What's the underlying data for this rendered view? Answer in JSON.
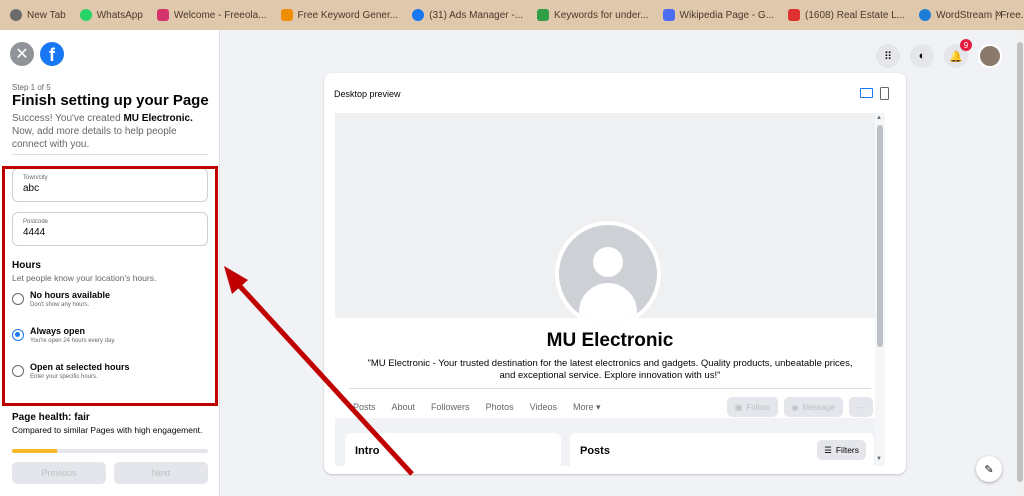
{
  "bookmarks": [
    {
      "label": "New Tab",
      "color": "#6b6b6b"
    },
    {
      "label": "WhatsApp",
      "color": "#25d366"
    },
    {
      "label": "Welcome - Freeola...",
      "color": "#d6336c"
    },
    {
      "label": "Free Keyword Gener...",
      "color": "#f08c00"
    },
    {
      "label": "(31) Ads Manager -...",
      "color": "#1877f2"
    },
    {
      "label": "Keywords for under...",
      "color": "#2f9e44"
    },
    {
      "label": "Wikipedia Page - G...",
      "color": "#4c6ef5"
    },
    {
      "label": "(1608) Real Estate L...",
      "color": "#e03131"
    },
    {
      "label": "WordStream | Free...",
      "color": "#1c7ed6"
    }
  ],
  "bookmarks_more": "»",
  "header": {
    "notif_count": "9"
  },
  "left": {
    "step": "Step 1 of 5",
    "title": "Finish setting up your Page",
    "desc_prefix": "Success! You've created ",
    "desc_page": "MU Electronic.",
    "desc_suffix": " Now, add more details to help people connect with you.",
    "town_label": "Town/city",
    "town_value": "abc",
    "post_label": "Postcode",
    "post_value": "4444",
    "hours_title": "Hours",
    "hours_sub": "Let people know your location's hours.",
    "options": [
      {
        "title": "No hours available",
        "sub": "Don't show any hours."
      },
      {
        "title": "Always open",
        "sub": "You're open 24 hours every day."
      },
      {
        "title": "Open at selected hours",
        "sub": "Enter your specific hours."
      }
    ],
    "health_title": "Page health: fair",
    "health_sub": "Compared to similar Pages with high engagement.",
    "health_progress": 0.23,
    "prev": "Previous",
    "next": "Next"
  },
  "preview": {
    "label": "Desktop preview",
    "page_name": "MU Electronic",
    "bio": "\"MU Electronic - Your trusted destination for the latest electronics and gadgets. Quality products, unbeatable prices, and exceptional service. Explore innovation with us!\"",
    "tabs": [
      "Posts",
      "About",
      "Followers",
      "Photos",
      "Videos",
      "More ▾"
    ],
    "follow": "Follow",
    "message": "Message",
    "more_dots": "···",
    "intro": "Intro",
    "posts": "Posts",
    "filters": "Filters"
  },
  "colors": {
    "accent": "#1877f2",
    "annotation": "#c00000"
  }
}
